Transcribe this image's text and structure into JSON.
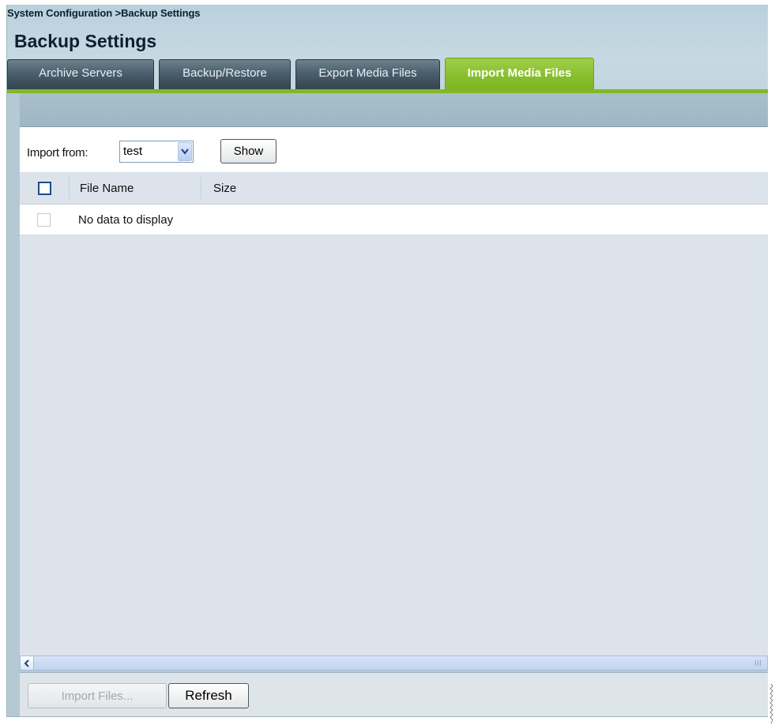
{
  "breadcrumb": "System Configuration >Backup Settings",
  "page_title": "Backup Settings",
  "tabs": [
    {
      "label": "Archive Servers",
      "active": false
    },
    {
      "label": "Backup/Restore",
      "active": false
    },
    {
      "label": "Export Media Files",
      "active": false
    },
    {
      "label": "Import Media Files",
      "active": true
    }
  ],
  "import_from": {
    "label": "Import from:",
    "selected_value": "test"
  },
  "show_button": "Show",
  "table": {
    "columns": [
      "File Name",
      "Size"
    ],
    "empty_message": "No data to display"
  },
  "footer": {
    "import_files_button": "Import Files...",
    "refresh_button": "Refresh"
  },
  "colors": {
    "active_tab": "#86bd2c",
    "inactive_tab": "#4c5f6d",
    "grid_background": "#dce3ea"
  }
}
